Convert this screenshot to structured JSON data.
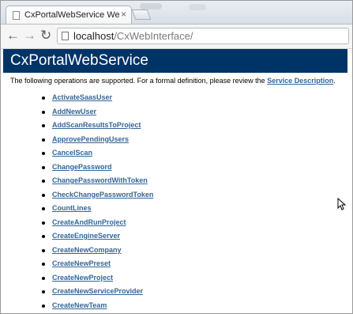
{
  "browser": {
    "tab_title": "CxPortalWebService Web",
    "tab_close": "×",
    "back_glyph": "←",
    "forward_glyph": "→",
    "reload_glyph": "↻",
    "url_host": "localhost",
    "url_path": "/CxWebInterface/"
  },
  "page": {
    "heading": "CxPortalWebService",
    "intro_text": "The following operations are supported. For a formal definition, please review the ",
    "intro_link": "Service Description",
    "intro_end": ".",
    "banner_color": "#003366",
    "link_color": "#336699"
  },
  "operations": [
    "ActivateSaasUser",
    "AddNewUser",
    "AddScanResultsToProject",
    "ApprovePendingUsers",
    "CancelScan",
    "ChangePassword",
    "ChangePasswordWithToken",
    "CheckChangePasswordToken",
    "CountLines",
    "CreateAndRunProject",
    "CreateEngineServer",
    "CreateNewCompany",
    "CreateNewPreset",
    "CreateNewProject",
    "CreateNewServiceProvider",
    "CreateNewTeam"
  ]
}
